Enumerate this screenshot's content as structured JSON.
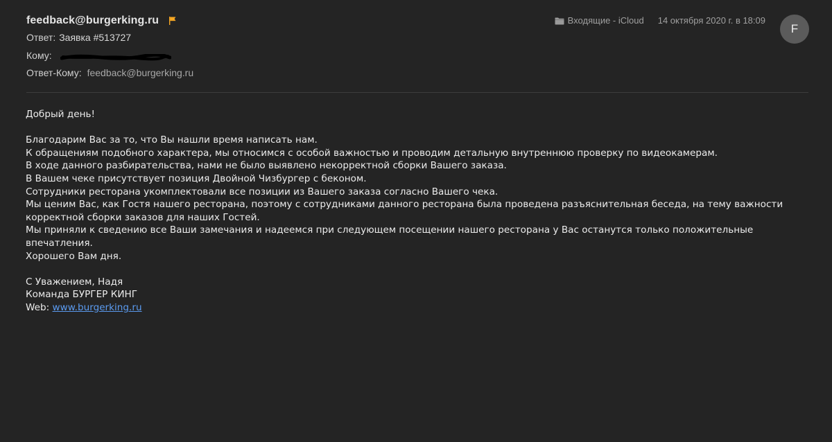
{
  "header": {
    "sender": "feedback@burgerking.ru",
    "subject_label": "Ответ:",
    "subject": "Заявка #513727",
    "to_label": "Кому:",
    "reply_to_label": "Ответ-Кому:",
    "reply_to": "feedback@burgerking.ru",
    "mailbox": "Входящие - iCloud",
    "date": "14 октября 2020 г. в 18:09",
    "avatar_initial": "F",
    "flag_color": "#f5a623"
  },
  "body": {
    "greeting": "Добрый день!",
    "paragraphs": [
      "Благодарим Вас за то, что Вы нашли время написать нам.",
      "К обращениям подобного характера, мы относимся с особой важностью и проводим детальную внутреннюю проверку по видеокамерам.",
      "В ходе данного разбирательства, нами не было выявлено некорректной сборки Вашего заказа.",
      "В Вашем чеке присутствует позиция Двойной Чизбургер с беконом.",
      "Сотрудники ресторана укомплектовали все позиции из Вашего заказа согласно Вашего чека.",
      "Мы ценим Вас, как Гостя нашего ресторана, поэтому с сотрудниками данного ресторана была проведена разъяснительная беседа, на тему важности корректной сборки заказов для наших Гостей.",
      "Мы приняли к сведению все Ваши замечания и надеемся при следующем посещении нашего ресторана у Вас останутся только положительные впечатления.",
      "Хорошего Вам дня."
    ],
    "signature": {
      "line1": "С Уважением, Надя",
      "line2": "Команда БУРГЕР КИНГ",
      "web_label": "Web:",
      "web_link": "www.burgerking.ru"
    }
  }
}
